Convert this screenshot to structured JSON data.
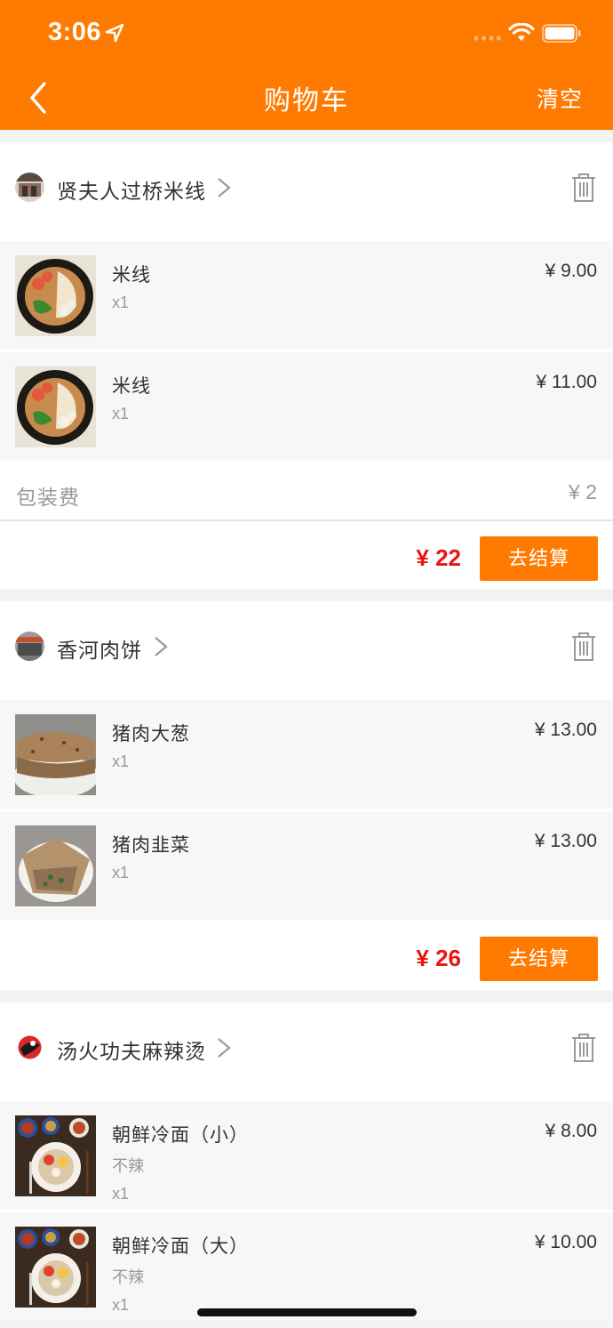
{
  "status_bar": {
    "time": "3:06"
  },
  "header": {
    "title": "购物车",
    "clear_label": "清空"
  },
  "currency": "¥",
  "shops": [
    {
      "name": "贤夫人过桥米线",
      "items": [
        {
          "name": "米线",
          "spec": "",
          "qty": "x1",
          "price": "¥ 9.00"
        },
        {
          "name": "米线",
          "spec": "",
          "qty": "x1",
          "price": "¥ 11.00"
        }
      ],
      "packaging": {
        "label": "包装费",
        "value": "¥ 2"
      },
      "total": "¥ 22",
      "checkout_label": "去结算"
    },
    {
      "name": "香河肉饼",
      "items": [
        {
          "name": "猪肉大葱",
          "spec": "",
          "qty": "x1",
          "price": "¥ 13.00"
        },
        {
          "name": "猪肉韭菜",
          "spec": "",
          "qty": "x1",
          "price": "¥ 13.00"
        }
      ],
      "total": "¥ 26",
      "checkout_label": "去结算"
    },
    {
      "name": "汤火功夫麻辣烫",
      "items": [
        {
          "name": "朝鲜冷面（小）",
          "spec": "不辣",
          "qty": "x1",
          "price": "¥ 8.00"
        },
        {
          "name": "朝鲜冷面（大）",
          "spec": "不辣",
          "qty": "x1",
          "price": "¥ 10.00"
        }
      ]
    }
  ],
  "colors": {
    "brand": "#ff7a00",
    "price_red": "#e8150f"
  }
}
